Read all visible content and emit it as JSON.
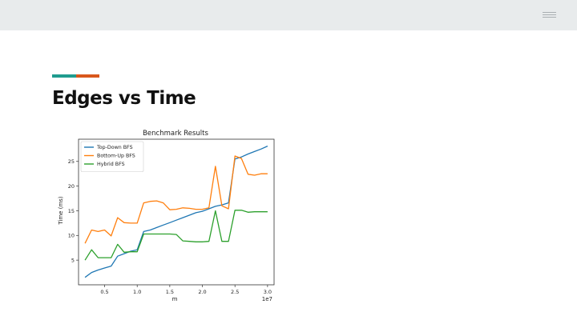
{
  "slide": {
    "title": "Edges vs Time",
    "accent_colors": [
      "#1f9c8f",
      "#d9571b"
    ]
  },
  "icons": {
    "menu": "hamburger-menu-icon"
  },
  "chart_data": {
    "type": "line",
    "title": "Benchmark Results",
    "xlabel": "m",
    "ylabel": "Time (ms)",
    "x_offset_label": "1e7",
    "xlim": [
      0.1,
      3.1
    ],
    "ylim": [
      0,
      29.5
    ],
    "x_ticks": [
      0.5,
      1.0,
      1.5,
      2.0,
      2.5,
      3.0
    ],
    "x_tick_labels": [
      "0.5",
      "1.0",
      "1.5",
      "2.0",
      "2.5",
      "3.0"
    ],
    "y_ticks": [
      5,
      10,
      15,
      20,
      25
    ],
    "y_tick_labels": [
      "5",
      "10",
      "15",
      "20",
      "25"
    ],
    "grid": false,
    "legend": "top-left",
    "x": [
      0.2,
      0.3,
      0.4,
      0.5,
      0.6,
      0.7,
      0.8,
      0.9,
      1.0,
      1.1,
      1.2,
      1.3,
      1.4,
      1.5,
      1.6,
      1.7,
      1.8,
      1.9,
      2.0,
      2.1,
      2.2,
      2.3,
      2.4,
      2.5,
      2.6,
      2.7,
      2.8,
      2.9,
      3.0
    ],
    "series": [
      {
        "name": "Top-Down BFS",
        "color": "#1f77b4",
        "values": [
          1.5,
          2.5,
          3.0,
          3.4,
          3.8,
          5.8,
          6.3,
          6.8,
          7.1,
          10.8,
          11.1,
          11.6,
          12.1,
          12.6,
          13.1,
          13.6,
          14.1,
          14.6,
          14.9,
          15.4,
          15.9,
          16.2,
          16.6,
          25.5,
          25.9,
          26.5,
          27.0,
          27.5,
          28.1
        ]
      },
      {
        "name": "Bottom-Up BFS",
        "color": "#ff7f0e",
        "values": [
          8.4,
          11.1,
          10.8,
          11.1,
          9.9,
          13.6,
          12.6,
          12.5,
          12.5,
          16.6,
          16.9,
          17.0,
          16.6,
          15.2,
          15.3,
          15.6,
          15.5,
          15.3,
          15.3,
          15.6,
          24.0,
          16.0,
          15.4,
          26.1,
          25.6,
          22.4,
          22.2,
          22.5,
          22.5
        ]
      },
      {
        "name": "Hybrid BFS",
        "color": "#2ca02c",
        "values": [
          5.0,
          7.1,
          5.5,
          5.5,
          5.5,
          8.2,
          6.6,
          6.7,
          6.7,
          10.3,
          10.3,
          10.3,
          10.3,
          10.3,
          10.2,
          8.9,
          8.8,
          8.7,
          8.7,
          8.8,
          15.0,
          8.8,
          8.8,
          15.1,
          15.1,
          14.7,
          14.8,
          14.8,
          14.8
        ]
      }
    ]
  }
}
